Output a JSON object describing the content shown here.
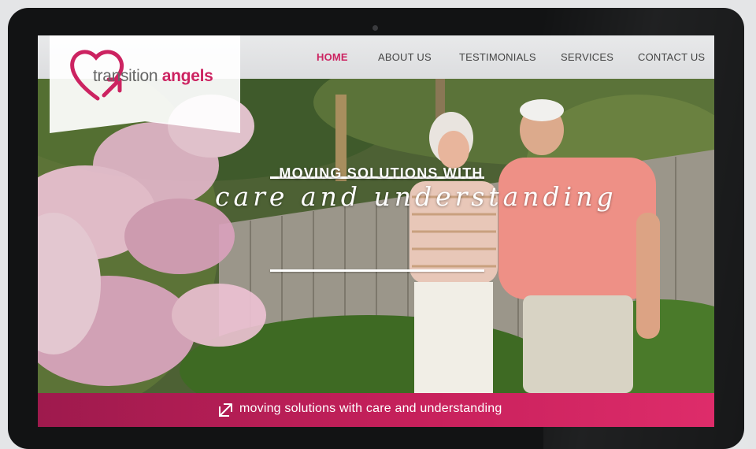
{
  "brand": {
    "name_part1": "transition",
    "name_part2": "angels",
    "accent_color": "#cc2361"
  },
  "nav": {
    "items": [
      {
        "label": "HOME",
        "active": true
      },
      {
        "label": "ABOUT US",
        "active": false
      },
      {
        "label": "TESTIMONIALS",
        "active": false
      },
      {
        "label": "SERVICES",
        "active": false
      },
      {
        "label": "CONTACT US",
        "active": false
      }
    ]
  },
  "hero": {
    "title": "MOVING SOLUTIONS WITH",
    "script": "care and understanding"
  },
  "footer": {
    "icon": "arrow-up-right-icon",
    "text": "moving solutions with care and understanding"
  }
}
